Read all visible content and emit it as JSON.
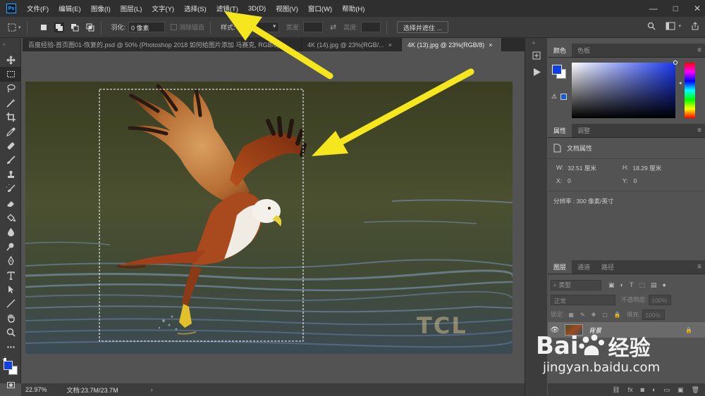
{
  "app": {
    "logo": "Ps"
  },
  "menu": [
    "文件(F)",
    "编辑(E)",
    "图像(I)",
    "图层(L)",
    "文字(Y)",
    "选择(S)",
    "滤镜(T)",
    "3D(D)",
    "视图(V)",
    "窗口(W)",
    "帮助(H)"
  ],
  "window_controls": {
    "minimize": "—",
    "restore": "□",
    "close": "✕"
  },
  "options": {
    "feather_label": "羽化:",
    "feather_value": "0 像素",
    "antialias_label": "消除锯齿",
    "style_label": "样式:",
    "style_value": "",
    "width_label": "宽度:",
    "height_label": "高度:",
    "select_mask_btn": "选择并遮住 ..."
  },
  "tabs": [
    {
      "label": "百度经验-首页图01-恢复的.psd @ 50% (Photoshop 2018  如何给图片添加 马赛克, RGB/8) ×",
      "active": false
    },
    {
      "label": "4K (14).jpg @ 23%(RGB/...",
      "active": false,
      "close": "×"
    },
    {
      "label": "4K (13).jpg @ 23%(RGB/8)",
      "active": true,
      "close": "×"
    }
  ],
  "canvas": {
    "watermark_text": "TCL"
  },
  "status": {
    "zoom": "22.97%",
    "doc": "文档:23.7M/23.7M",
    "arrow": "›"
  },
  "color_panel": {
    "tabs": [
      "颜色",
      "色板"
    ],
    "fg_color": "#1040e0",
    "bg_color": "#ffffff",
    "picker_hue": "#1a38f0"
  },
  "properties_panel": {
    "tabs": [
      "属性",
      "调整"
    ],
    "title": "文档属性",
    "w_label": "W:",
    "w_value": "32.51 厘米",
    "h_label": "H:",
    "h_value": "18.29 厘米",
    "x_label": "X:",
    "x_value": "0",
    "y_label": "Y:",
    "y_value": "0",
    "resolution": "分辨率 : 300 像素/英寸"
  },
  "layers_panel": {
    "tabs": [
      "图层",
      "通道",
      "路径"
    ],
    "filter_placeholder": "类型",
    "blend_mode": "正常",
    "opacity_label": "不透明度:",
    "opacity_value": "100%",
    "lock_label": "锁定:",
    "fill_label": "填充:",
    "fill_value": "100%",
    "layer_name": "背景"
  },
  "baidu_watermark": {
    "brand_left": "Bai",
    "brand_right": "经验",
    "url": "jingyan.baidu.com"
  }
}
